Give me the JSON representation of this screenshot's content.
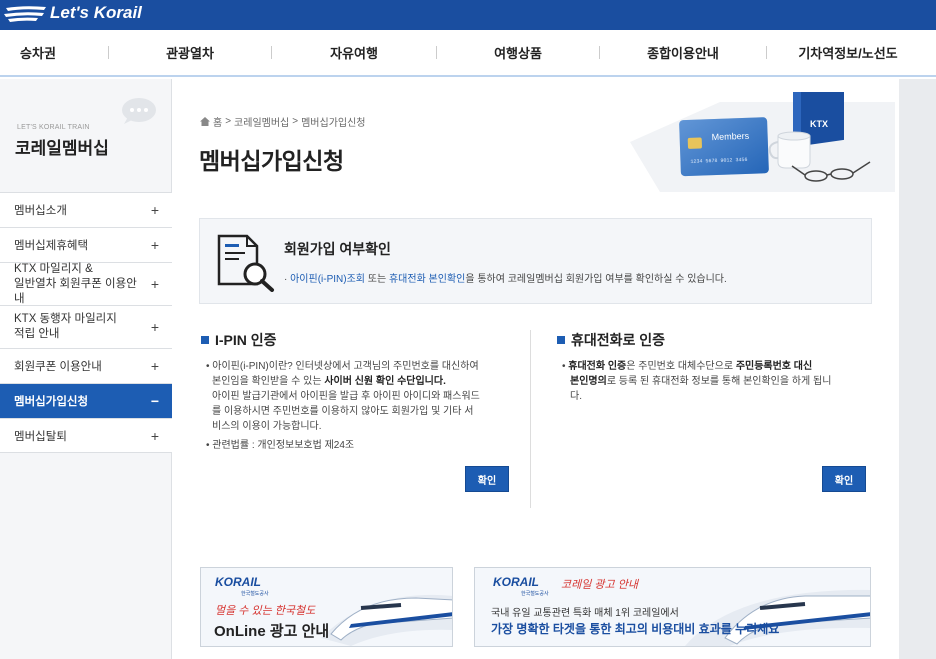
{
  "header": {
    "logo_text": "Let's Korail"
  },
  "nav": [
    "승차권",
    "관광열차",
    "자유여행",
    "여행상품",
    "종합이용안내",
    "기차역정보/노선도"
  ],
  "sidebar": {
    "subtitle": "LET'S KORAIL TRAIN",
    "title": "코레일멤버십",
    "items": [
      {
        "label": "멤버십소개",
        "toggle": "+"
      },
      {
        "label": "멤버십제휴혜택",
        "toggle": "+"
      },
      {
        "label": "KTX 마일리지 &\n일반열차 회원쿠폰 이용안내",
        "toggle": "+"
      },
      {
        "label": "KTX 동행자 마일리지\n적립 안내",
        "toggle": "+"
      },
      {
        "label": "회원쿠폰 이용안내",
        "toggle": "+"
      },
      {
        "label": "멤버십가입신청",
        "toggle": "−"
      },
      {
        "label": "멤버십탈퇴",
        "toggle": "+"
      }
    ]
  },
  "breadcrumb": [
    "홈",
    "코레일멤버십",
    "멤버십가입신청"
  ],
  "page_title": "멤버십가입신청",
  "visual": {
    "card_label": "Members",
    "book_label": "KTX"
  },
  "confirm": {
    "title": "회원가입 여부확인",
    "desc_link1": "아이핀(i-PIN)조회",
    "desc_mid": " 또는 ",
    "desc_link2": "휴대전화 본인확인",
    "desc_rest": "을 통하여 코레일멤버십 회원가입 여부를 확인하실 수 있습니다."
  },
  "ipin": {
    "title": "I-PIN 인증",
    "p1_a": "아이핀(i-PIN)이란? 인터넷상에서 고객님의 주민번호를 대신하여",
    "p1_b": "본인임을 확인받을 수 있는 ",
    "p1_bold": "사이버 신원 확인 수단입니다.",
    "p1_c": "아이핀 발급기관에서 아이핀을 발급 후 아이핀 아이디와 패스워드",
    "p1_d": "를 이용하시면 주민번호를 이용하지 않아도 회원가입 및 기타 서",
    "p1_e": "비스의 이용이 가능합니다.",
    "p2": "관련법률 : 개인정보보호법 제24조",
    "button": "확인"
  },
  "phone": {
    "title": "휴대전화로 인증",
    "l1_bold1": "휴대전화 인증",
    "l1_a": "은 주민번호 대체수단으로 ",
    "l1_bold2": "주민등록번호 대신",
    "l2_bold": "본인명의",
    "l2_a": "로 등록 된 휴대전화 정보를 통해 본인확인을 하게 됩니",
    "l3": "다.",
    "button": "확인"
  },
  "banner1": {
    "logo": "KORAIL",
    "logo_sub": "한국철도공사",
    "script": "멀을 수 있는 한국철도",
    "main": "OnLine 광고 안내"
  },
  "banner2": {
    "logo": "KORAIL",
    "logo_sub": "한국철도공사",
    "script": "코레일 광고 안내",
    "line1": "국내 유일 교통관련 특화 매체 1위 코레일에서",
    "line2": "가장 명확한 타겟을 통한 최고의 비용대비 효과를 누리세요"
  },
  "colors": {
    "brand_blue": "#1a4ea0",
    "accent_blue": "#1d5db3"
  }
}
